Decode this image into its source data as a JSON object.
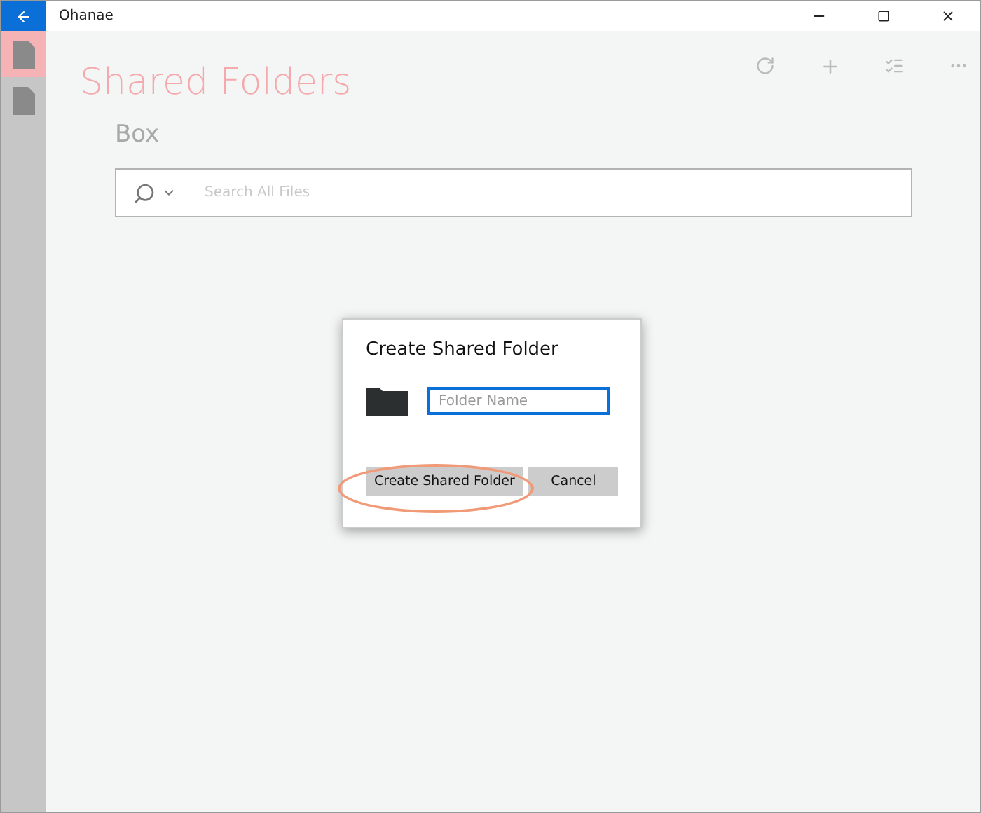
{
  "window": {
    "title": "Ohanae"
  },
  "sidebar": {
    "items": [
      {
        "kind": "document",
        "selected": true
      },
      {
        "kind": "document",
        "selected": false
      }
    ]
  },
  "page": {
    "title": "Shared Folders",
    "subtitle": "Box"
  },
  "search": {
    "placeholder": "Search All Files"
  },
  "dialog": {
    "title": "Create Shared Folder",
    "field": {
      "placeholder": "Folder Name",
      "focused": true
    },
    "buttons": [
      {
        "label": "Create Shared Folder"
      },
      {
        "label": "Cancel"
      }
    ]
  }
}
